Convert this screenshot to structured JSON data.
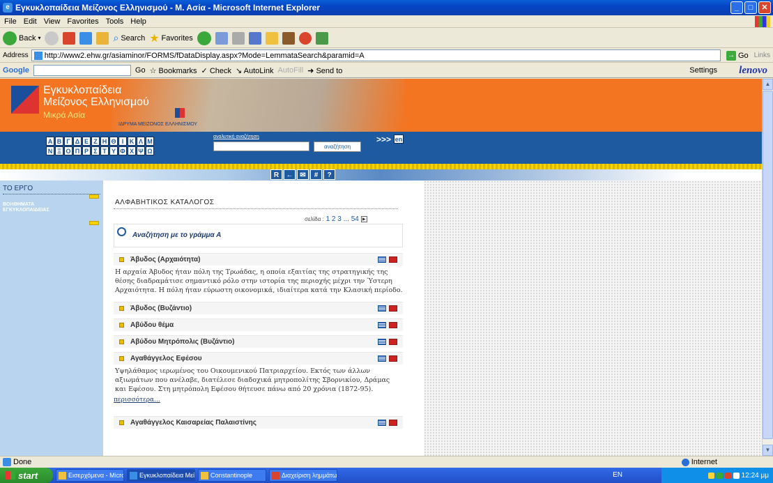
{
  "window": {
    "title": "Εγκυκλοπαίδεια Μείζονος Ελληνισμού - Μ. Ασία - Microsoft Internet Explorer",
    "controls": [
      "_",
      "□",
      "✕"
    ]
  },
  "menu": [
    "File",
    "Edit",
    "View",
    "Favorites",
    "Tools",
    "Help"
  ],
  "toolbar": {
    "back": "Back",
    "search": "Search",
    "favorites": "Favorites"
  },
  "address": {
    "label": "Address",
    "url": "http://www2.ehw.gr/asiaminor/FORMS/fDataDisplay.aspx?Mode=LemmataSearch&paramid=A",
    "go": "Go",
    "links": "Links"
  },
  "googlebar": {
    "logo": "Google",
    "go": "Go",
    "bookmarks": "Bookmarks",
    "check": "Check",
    "autolink": "AutoLink",
    "autofill": "AutoFill",
    "sendto": "Send to",
    "settings": "Settings",
    "brand": "lenovo"
  },
  "site": {
    "title_line1": "Εγκυκλοπαίδεια",
    "title_line2": "Μείζονος Ελληνισμού",
    "subtitle": "Μικρά Ασία",
    "foundation": "ΙΔΡΥΜΑ ΜΕΙΖΟΝΟΣ ΕΛΛΗΝΙΣΜΟΥ",
    "alphabet": [
      "Α",
      "Β",
      "Γ",
      "Δ",
      "Ε",
      "Ζ",
      "Η",
      "Θ",
      "Ι",
      "Κ",
      "Λ",
      "Μ",
      "Ν",
      "Ξ",
      "Ο",
      "Π",
      "Ρ",
      "Σ",
      "Τ",
      "Υ",
      "Φ",
      "Χ",
      "Ψ",
      "Ω"
    ],
    "search_label": "αναλυτική αναζήτηση",
    "search_button": "αναζήτηση",
    "arrows": ">>>",
    "lang": "en",
    "nav_icons": [
      "R",
      "←",
      "✉",
      "#",
      "?"
    ]
  },
  "left_panel": {
    "item1": "ΤΟ ΕΡΓΟ",
    "item2_line1": "ΒΟΗΘΗΜΑΤΑ",
    "item2_line2": "ΕΓΚΥΚΛΟΠΑΙΔΕΙΑΣ"
  },
  "content": {
    "heading": "ΑΛΦΑΒΗΤΙΚΟΣ ΚΑΤΑΛΟΓΟΣ",
    "pager_label": "σελίδα :",
    "pager_pages": "1 2 3 ... 54",
    "search_letter": "Αναζήτηση με το γράμμα Α",
    "lemmas": [
      {
        "name": "Άβυδος (Αρχαιότητα)",
        "body": "Η αρχαία Άβυδος ήταν πόλη της Τρωάδας, η οποία εξαιτίας της στρατηγικής της θέσης διαδραμάτισε σημαντικό ρόλο στην ιστορία της περιοχής μέχρι την Ύστερη Αρχαιότητα. Η πόλη ήταν εύρωστη οικονομικά, ιδιαίτερα κατά την Κλασική περίοδο."
      },
      {
        "name": "Άβυδος (Βυζάντιο)",
        "body": ""
      },
      {
        "name": "Αβύδου θέμα",
        "body": ""
      },
      {
        "name": "Αβύδου Μητρόπολις (Βυζάντιο)",
        "body": ""
      },
      {
        "name": "Αγαθάγγελος Εφέσου",
        "body": "Υψηλάθαμος ιερωμένος του Οικουμενικού Πατριαρχείου. Εκτός των άλλων αξιωμάτων που ανέλαβε, διατέλεσε διαδοχικά μητροπολίτης Σβορνικίου, Δράμας και Εφέσου. Στη μητρόπολη Εφέσου θήτευσε πάνω από 20 χρόνια (1872-95).",
        "more": "περισσότερα..."
      },
      {
        "name": "Αγαθάγγελος Καισαρείας Παλαιστίνης",
        "body": ""
      }
    ]
  },
  "status": {
    "left": "Done",
    "zone": "Internet"
  },
  "taskbar": {
    "start": "start",
    "tasks": [
      "Εισερχόμενα - Micros...",
      "Εγκυκλοπαίδεια Μείζο...",
      "Constantinople",
      "Διαχείριση λημμάτων ..."
    ],
    "lang": "EN",
    "time": "12:24 μμ"
  }
}
